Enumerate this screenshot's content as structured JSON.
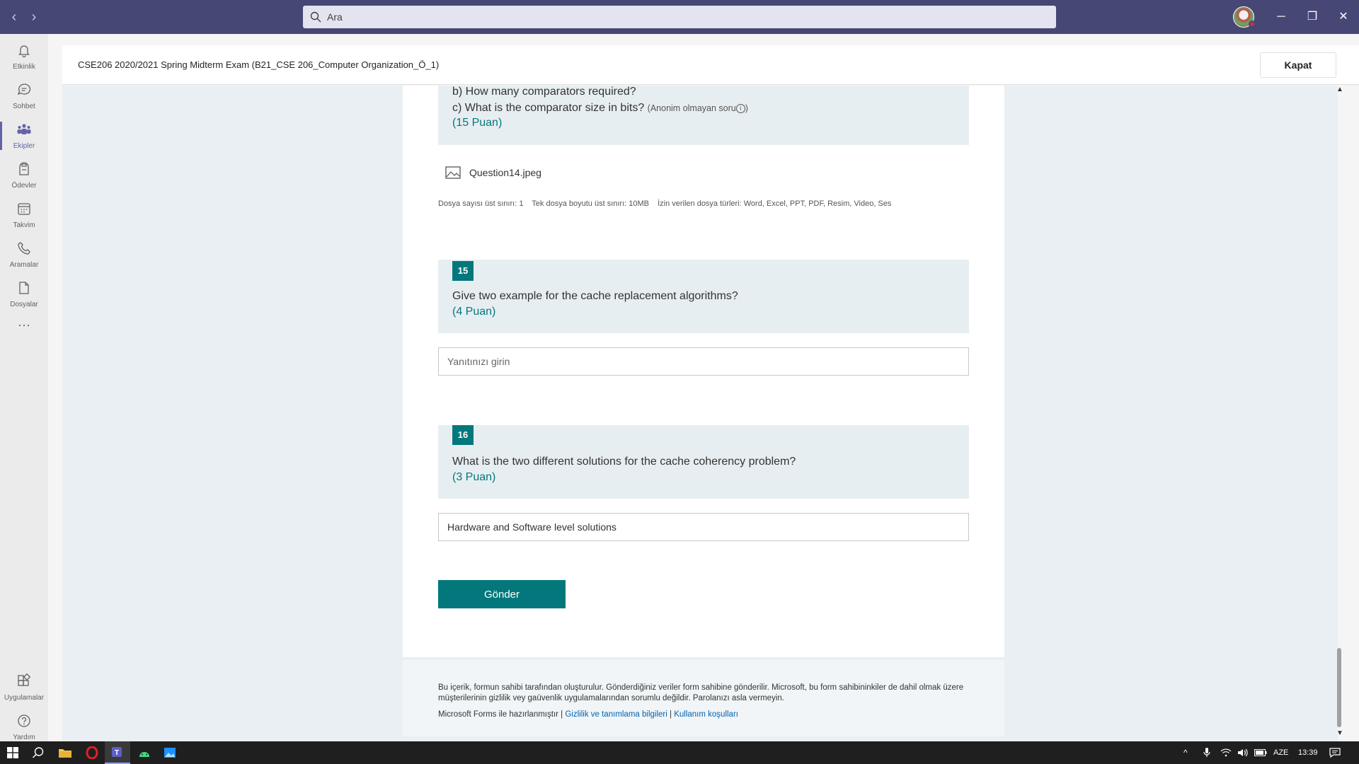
{
  "titlebar": {
    "search_placeholder": "Ara",
    "back": "‹",
    "forward": "›",
    "minimize": "─",
    "maximize": "❐",
    "close": "✕"
  },
  "rail": {
    "items": [
      {
        "label": "Etkinlik",
        "icon": "bell-icon"
      },
      {
        "label": "Sohbet",
        "icon": "chat-icon"
      },
      {
        "label": "Ekipler",
        "icon": "teams-icon",
        "active": true
      },
      {
        "label": "Ödevler",
        "icon": "assignments-icon"
      },
      {
        "label": "Takvim",
        "icon": "calendar-icon"
      },
      {
        "label": "Aramalar",
        "icon": "phone-icon"
      },
      {
        "label": "Dosyalar",
        "icon": "file-icon"
      }
    ],
    "more": "···",
    "apps": "Uygulamalar",
    "help": "Yardım"
  },
  "header": {
    "title": "CSE206 2020/2021 Spring Midterm Exam (B21_CSE 206_Computer Organization_Ö_1)",
    "close_label": "Kapat"
  },
  "q14": {
    "line_b": "b) How many comparators required?",
    "line_c": "c) What is the comparator size in bits?",
    "anon": "(Anonim olmayan soru",
    "anon_close": ")",
    "points": "(15 Puan)",
    "file_name": "Question14.jpeg",
    "limits": [
      "Dosya sayısı üst sınırı: 1",
      "Tek dosya boyutu üst sınırı: 10MB",
      "İzin verilen dosya türleri: Word, Excel, PPT, PDF, Resim, Video, Ses"
    ]
  },
  "q15": {
    "number": "15",
    "text": "Give two example for the cache replacement algorithms?",
    "points": "(4 Puan)",
    "answer_placeholder": "Yanıtınızı girin",
    "answer_value": ""
  },
  "q16": {
    "number": "16",
    "text": "What is the two different solutions for the cache coherency problem?",
    "points": "(3 Puan)",
    "answer_value": "Hardware and Software level solutions"
  },
  "submit_label": "Gönder",
  "footer": {
    "disclaimer": "Bu içerik, formun sahibi tarafından oluşturulur. Gönderdiğiniz veriler form sahibine gönderilir. Microsoft, bu form sahibininkiler de dahil olmak üzere müşterilerinin gizlilik vey gaüvenlik uygulamalarından sorumlu değildir. Parolanızı asla vermeyin.",
    "powered": "Microsoft Forms ile hazırlanmıştır |",
    "privacy_link": "Gizlilik ve tanımlama bilgileri",
    "separator": "|",
    "terms_link": "Kullanım koşulları"
  },
  "taskbar": {
    "language": "AZE",
    "time": "13:39"
  },
  "colors": {
    "titlebar": "#464775",
    "accent": "#03787c",
    "rail_active": "#6264a7"
  }
}
